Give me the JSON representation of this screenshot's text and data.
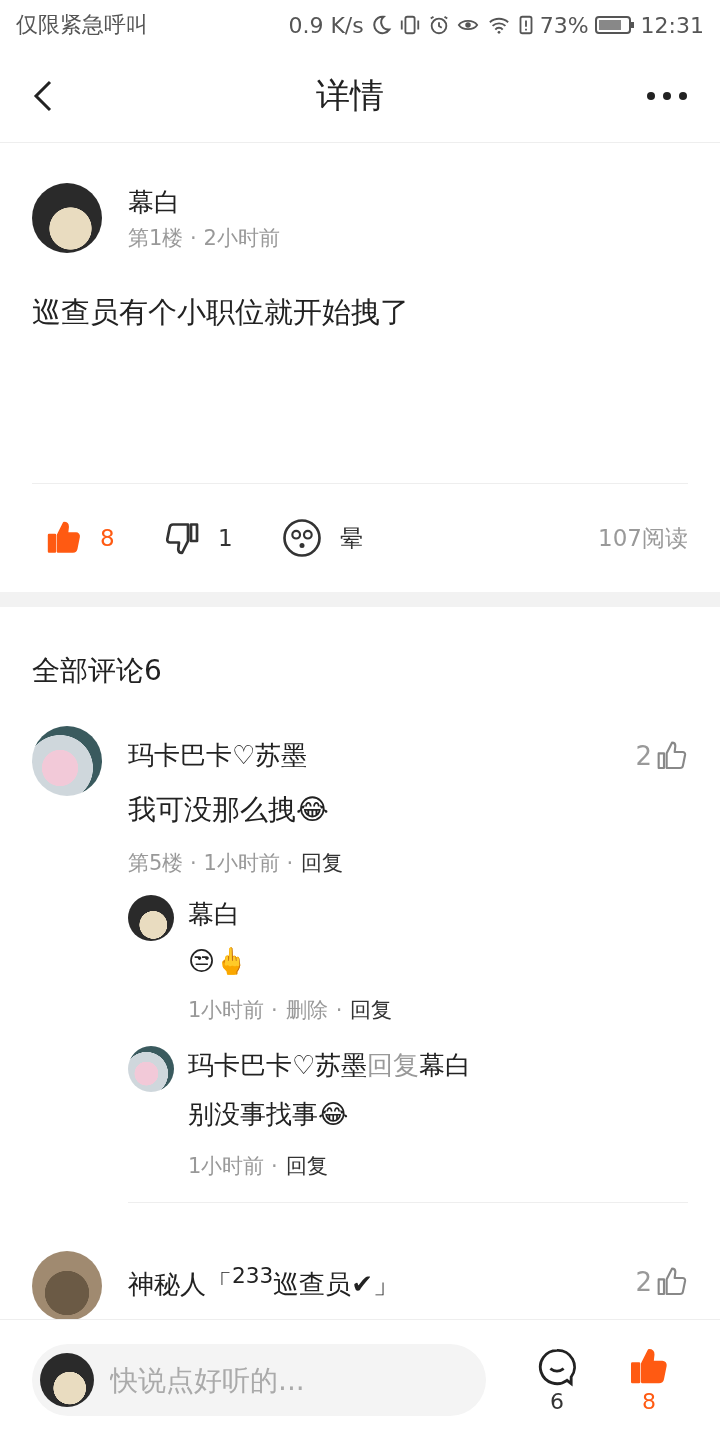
{
  "status_bar": {
    "carrier": "仅限紧急呼叫",
    "speed": "0.9 K/s",
    "battery": "73%",
    "time": "12:31"
  },
  "header": {
    "title": "详情"
  },
  "post": {
    "author": "幕白",
    "meta": "第1楼 · 2小时前",
    "text": "巡查员有个小职位就开始拽了",
    "likes": "8",
    "liked": true,
    "dislikes": "1",
    "reaction": "晕",
    "reads": "107阅读"
  },
  "comments_title": "全部评论6",
  "comments": [
    {
      "author": "玛卡巴卡♡苏墨",
      "likes": "2",
      "liked": false,
      "text": "我可没那么拽😂",
      "meta": "第5楼 · 1小时前 ·",
      "reply": "回复",
      "replies": [
        {
          "author": "幕白",
          "text": "😒🖕",
          "time": "1小时前 ·",
          "delete": "删除",
          "delete_sep": "·",
          "reply": "回复"
        },
        {
          "author": "玛卡巴卡♡苏墨",
          "reply_word": "回复",
          "target": "幕白",
          "text": "别没事找事😂",
          "time": "1小时前 ·",
          "reply": "回复"
        }
      ]
    },
    {
      "author": "神秘人「$^{233}$巡查员✔」",
      "likes": "2",
      "liked": false
    }
  ],
  "composer": {
    "placeholder": "快说点好听的...",
    "comments": "6",
    "likes": "8",
    "liked": true
  }
}
